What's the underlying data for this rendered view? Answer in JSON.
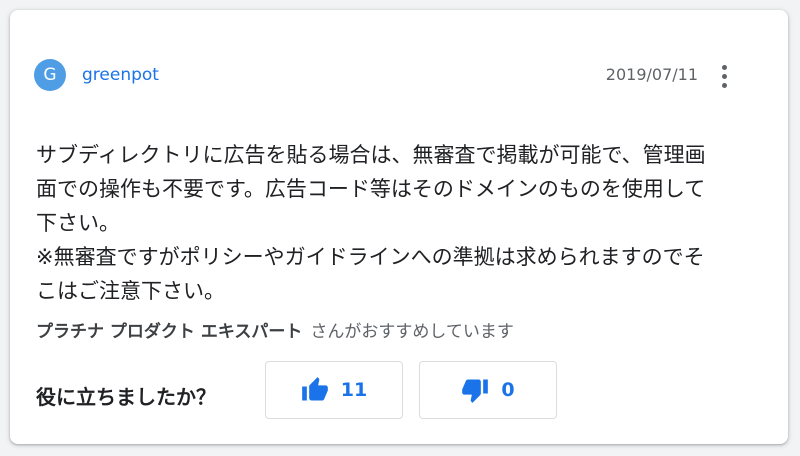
{
  "author": {
    "initial": "G",
    "name": "greenpot"
  },
  "date": "2019/07/11",
  "body": "サブディレクトリに広告を貼る場合は、無審査で掲載が可能で、管理画\n面での操作も不要です。広告コード等はそのドメインのものを使用して\n下さい。\n※無審査ですがポリシーやガイドラインへの準拠は求められますのでそ\nこはご注意下さい。",
  "recommendation": {
    "badge": "プラチナ プロダクト エキスパート",
    "suffix": "さんがおすすめしています"
  },
  "helpful": {
    "question": "役に立ちましたか？",
    "up_count": "11",
    "down_count": "0"
  },
  "icons": {
    "menu": "more-vert-icon",
    "up": "thumb-up-icon",
    "down": "thumb-down-icon"
  },
  "colors": {
    "accent": "#1a73e8",
    "avatar": "#4f9de5"
  }
}
